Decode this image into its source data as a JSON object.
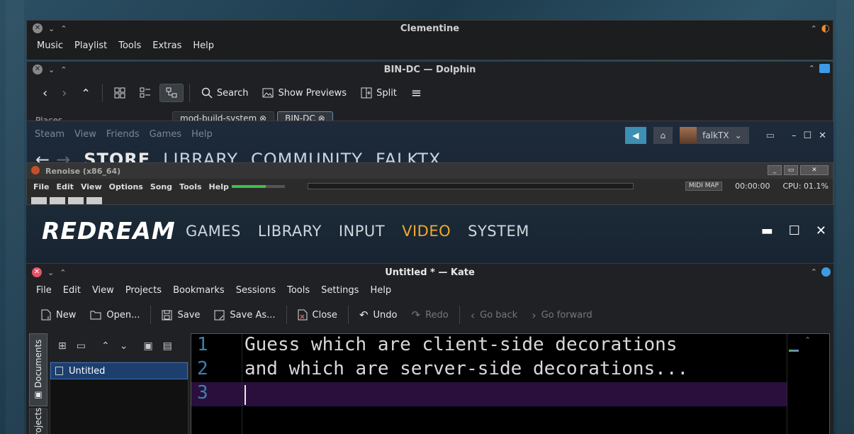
{
  "clementine": {
    "title": "Clementine",
    "menu": [
      "Music",
      "Playlist",
      "Tools",
      "Extras",
      "Help"
    ]
  },
  "dolphin": {
    "title": "BIN-DC — Dolphin",
    "toolbar": {
      "search": "Search",
      "show_previews": "Show Previews",
      "split": "Split"
    },
    "places_label": "Places",
    "tabs": [
      "mod-build-system",
      "BIN-DC"
    ]
  },
  "steam": {
    "menu": [
      "Steam",
      "View",
      "Friends",
      "Games",
      "Help"
    ],
    "nav": [
      "STORE",
      "LIBRARY",
      "COMMUNITY",
      "FALKTX"
    ],
    "username": "falkTX"
  },
  "renoise": {
    "title": "Renoise (x86_64)",
    "menu": [
      "File",
      "Edit",
      "View",
      "Options",
      "Song",
      "Tools",
      "Help"
    ],
    "midi_map": "MIDI MAP",
    "time": "00:00:00",
    "cpu": "CPU: 01.1%"
  },
  "redream": {
    "logo": "REDREAM",
    "nav": [
      "GAMES",
      "LIBRARY",
      "INPUT",
      "VIDEO",
      "SYSTEM"
    ],
    "active": "VIDEO"
  },
  "kate": {
    "title": "Untitled * — Kate",
    "menu": [
      "File",
      "Edit",
      "View",
      "Projects",
      "Bookmarks",
      "Sessions",
      "Tools",
      "Settings",
      "Help"
    ],
    "toolbar": {
      "new": "New",
      "open": "Open...",
      "save": "Save",
      "save_as": "Save As...",
      "close": "Close",
      "undo": "Undo",
      "redo": "Redo",
      "go_back": "Go back",
      "go_forward": "Go forward"
    },
    "side_tabs": {
      "documents": "Documents",
      "projects": "Projects"
    },
    "document": "Untitled",
    "lines": [
      {
        "num": "1",
        "text": "Guess which are client-side decorations"
      },
      {
        "num": "2",
        "text": "and which are server-side decorations..."
      },
      {
        "num": "3",
        "text": ""
      }
    ]
  },
  "colors": {
    "accent_orange": "#f0a830",
    "kate_selection": "#1d3f6e",
    "current_line": "#2a0f3d",
    "close_red": "#e5536a"
  }
}
